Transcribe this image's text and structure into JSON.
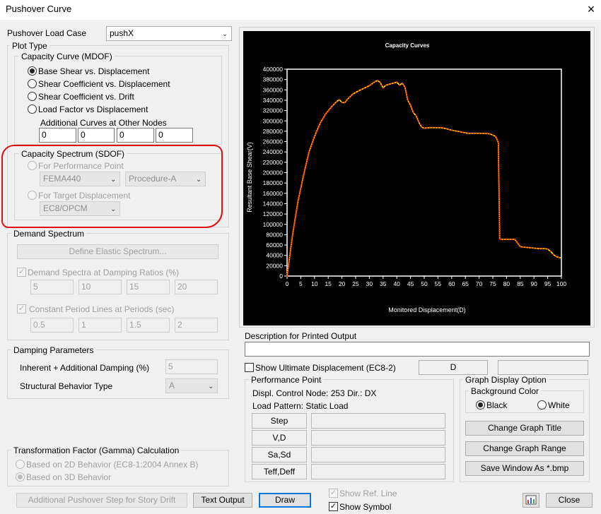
{
  "window": {
    "title": "Pushover Curve",
    "close_glyph": "×"
  },
  "load_case": {
    "label": "Pushover Load Case",
    "value": "pushX"
  },
  "plot_type": {
    "label": "Plot Type"
  },
  "capacity_curve": {
    "label": "Capacity Curve (MDOF)",
    "options": [
      "Base Shear vs. Displacement",
      "Shear Coefficient vs. Displacement",
      "Shear Coefficient vs. Drift",
      "Load Factor vs Displacement"
    ],
    "additional_label": "Additional Curves at Other Nodes",
    "nodes": [
      "0",
      "0",
      "0",
      "0"
    ]
  },
  "capacity_spectrum": {
    "label": "Capacity Spectrum (SDOF)",
    "perf_point": "For Performance Point",
    "method": "FEMA440",
    "procedure": "Procedure-A",
    "target": "For Target Displacement",
    "target_method": "EC8/OPCM"
  },
  "demand": {
    "label": "Demand Spectrum",
    "define_button": "Define Elastic Spectrum...",
    "damping_label": "Demand Spectra at Damping Ratios (%)",
    "damping": [
      "5",
      "10",
      "15",
      "20"
    ],
    "period_label": "Constant Period Lines at Periods (sec)",
    "periods": [
      "0.5",
      "1",
      "1.5",
      "2"
    ]
  },
  "damping_params": {
    "label": "Damping Parameters",
    "inherent_label": "Inherent + Additional Damping (%)",
    "inherent_value": "5",
    "behavior_label": "Structural Behavior Type",
    "behavior_value": "A"
  },
  "gamma": {
    "label": "Transformation Factor (Gamma) Calculation",
    "opt2d": "Based on 2D Behavior (EC8-1:2004  Annex B)",
    "opt3d": "Based on 3D Behavior"
  },
  "buttons": {
    "story_drift": "Additional Pushover Step for Story Drift",
    "text_output": "Text Output",
    "draw": "Draw",
    "close": "Close",
    "bmp_icon": "bitmap-icon"
  },
  "show": {
    "ref_line": "Show Ref. Line",
    "symbol": "Show Symbol"
  },
  "description": {
    "label": "Description for Printed Output",
    "value": ""
  },
  "ultimate": {
    "label": "Show Ultimate Displacement  (EC8-2)",
    "code": "D",
    "value": ""
  },
  "performance": {
    "label": "Performance Point",
    "control_node": "Displ. Control Node: 253  Dir.: DX",
    "load_pattern": "Load Pattern: Static Load",
    "rows": [
      "Step",
      "V,D",
      "Sa,Sd",
      "Teff,Deff"
    ]
  },
  "graph_display": {
    "label": "Graph Display Option",
    "bg_label": "Background Color",
    "black": "Black",
    "white": "White",
    "change_title": "Change Graph Title",
    "change_range": "Change Graph Range",
    "save": "Save Window As *.bmp"
  },
  "colors": {
    "chart_bg": "#000000",
    "curve": "#ffff00",
    "marker": "#ff2a00",
    "annotation": "#e01010"
  },
  "chart_data": {
    "type": "line",
    "title": "Capacity Curves",
    "xlabel": "Monitored Displacement(D)",
    "ylabel": "Resultant Base Shear(V)",
    "xlim": [
      0,
      100
    ],
    "ylim": [
      0,
      400000
    ],
    "xticks": [
      "0",
      "5",
      "10",
      "15",
      "20",
      "25",
      "30",
      "35",
      "40",
      "45",
      "50",
      "55",
      "60",
      "65",
      "70",
      "75",
      "80",
      "85",
      "90",
      "95",
      "100"
    ],
    "yticks": [
      "0",
      "20000",
      "40000",
      "60000",
      "80000",
      "100000",
      "120000",
      "140000",
      "160000",
      "180000",
      "200000",
      "220000",
      "240000",
      "260000",
      "280000",
      "300000",
      "320000",
      "340000",
      "360000",
      "380000",
      "400000"
    ],
    "series": [
      {
        "x": [
          0,
          2,
          4,
          6,
          8,
          10,
          12,
          14,
          16,
          18,
          19,
          20,
          21,
          22,
          24,
          26,
          28,
          30,
          32,
          33,
          34,
          35,
          36,
          38,
          40,
          41,
          42,
          43,
          44,
          45,
          46,
          47,
          48,
          49,
          50,
          52,
          54,
          56,
          58,
          60,
          62,
          64,
          66,
          68,
          70,
          72,
          74,
          76,
          77,
          77.5,
          78,
          80,
          82,
          83,
          84,
          85,
          86,
          88,
          90,
          92,
          94,
          95,
          96,
          97,
          98,
          99,
          100
        ],
        "y": [
          0,
          80000,
          145000,
          195000,
          240000,
          270000,
          295000,
          313000,
          326000,
          337000,
          341000,
          336000,
          335000,
          342000,
          352000,
          358000,
          363000,
          368000,
          376000,
          378000,
          374000,
          364000,
          369000,
          372000,
          375000,
          369000,
          373000,
          365000,
          340000,
          330000,
          316000,
          310000,
          298000,
          288000,
          286000,
          287000,
          287000,
          287000,
          285000,
          282000,
          280000,
          278000,
          276000,
          276000,
          276000,
          276000,
          275000,
          270000,
          258000,
          72000,
          71000,
          71000,
          71000,
          71000,
          64000,
          57000,
          56000,
          55000,
          54000,
          53000,
          53000,
          52000,
          48000,
          42000,
          38000,
          36000,
          35000
        ]
      }
    ]
  }
}
